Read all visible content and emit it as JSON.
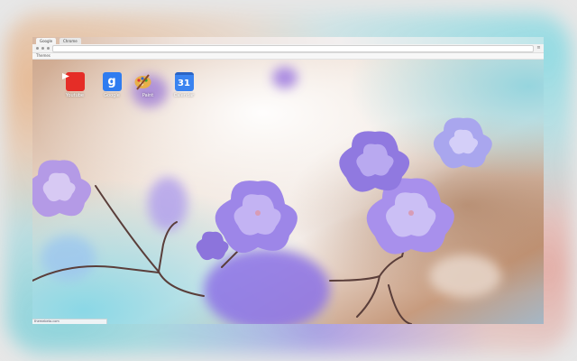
{
  "browser": {
    "tabs": [
      {
        "label": "Google"
      },
      {
        "label": "Chrome"
      }
    ],
    "bookmarks": [
      {
        "label": "Themes"
      }
    ],
    "menu_icon": "menu-icon"
  },
  "apps": [
    {
      "label": "Youtube",
      "icon": "youtube-icon",
      "color": "#e52d27"
    },
    {
      "label": "Google",
      "icon": "google-icon",
      "glyph": "g",
      "color": "#2f7cf0"
    },
    {
      "label": "Paint",
      "icon": "paint-palette-icon"
    },
    {
      "label": "Calendar",
      "icon": "calendar-icon",
      "glyph": "31",
      "color": "#3a83f0"
    }
  ],
  "status": {
    "text": "themebeta.com"
  },
  "background": {
    "subject": "purple blossoms on branches",
    "accent": "#8a6ee0"
  }
}
